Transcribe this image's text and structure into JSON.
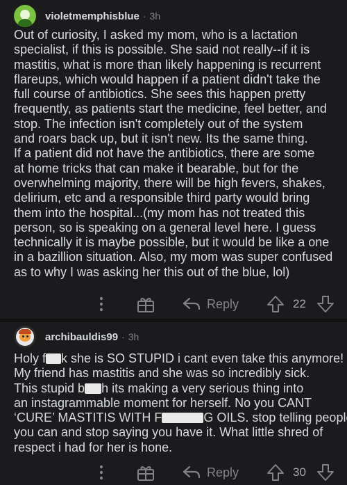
{
  "comments": [
    {
      "username": "violetmemphisblue",
      "separator": "·",
      "age": "3h",
      "lines": [
        "Out of curiosity, I asked my mom, who is a lactation",
        "specialist, if this is possible. She said not really--if it is",
        "mastitis, what is more than likely happening is recurrent",
        "flareups, which would happen if a patient didn't take the",
        "full course of antibiotics. She sees this happen pretty",
        "frequently, as patients start the medicine, feel better, and",
        "stop. The infection isn't completely out of the system",
        "and roars back up, but it isn't new. Its the same thing.",
        "If a patient did not have the antibiotics, there are some",
        "at home tricks that can make it bearable, but for the",
        "overwhelming majority, there will be high fevers, shakes,",
        "delirium, etc and a responsible third party would bring",
        "them into the hospital...(my mom has not treated this",
        "person, so is speaking on a general level here. I guess",
        "technically it is maybe possible, but it would be like a one",
        "in a bazillion situation. Also, my mom was super confused",
        "as to why I was asking her this out of the blue, lol)"
      ],
      "reply_label": "Reply",
      "score": "22",
      "icons": [
        "more-icon",
        "award-icon",
        "reply-icon",
        "upvote-icon",
        "downvote-icon"
      ]
    },
    {
      "username": "archibauldis99",
      "separator": "·",
      "age": "3h",
      "line1_a": "Holy f",
      "line1_b": "k she is SO STUPID i cant even take this anymore!",
      "line2": "My friend has mastitis and she was so incredibly sick.",
      "line3_a": "This stupid b",
      "line3_b": "h its making a very serious thing into",
      "line4": "an instagrammable moment for herself. No you CANT",
      "line5_a": "‘CURE’ MASTITIS WITH F",
      "line5_b": "G OILS. stop telling people",
      "line6": "you can and stop saying you have it. What little shred of",
      "line7": "respect i had for her is hone.",
      "reply_label": "Reply",
      "score": "30",
      "icons": [
        "more-icon",
        "award-icon",
        "reply-icon",
        "upvote-icon",
        "downvote-icon"
      ]
    }
  ],
  "colors": {
    "background": "#1b1b1d",
    "text": "#d7dadc",
    "muted": "#818384",
    "divider": "#111112"
  }
}
